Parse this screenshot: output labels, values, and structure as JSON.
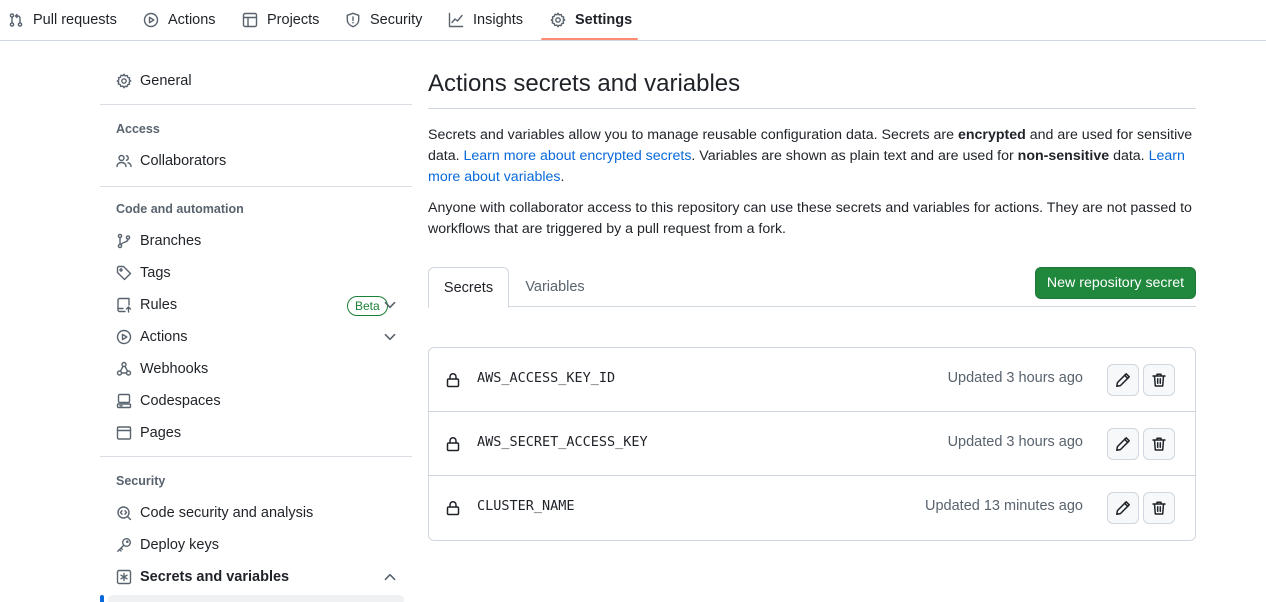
{
  "repo_nav": {
    "tabs": [
      {
        "label": "Pull requests",
        "icon": "git-pull-request-icon"
      },
      {
        "label": "Actions",
        "icon": "play-circle-icon"
      },
      {
        "label": "Projects",
        "icon": "table-icon"
      },
      {
        "label": "Security",
        "icon": "shield-icon"
      },
      {
        "label": "Insights",
        "icon": "graph-icon"
      },
      {
        "label": "Settings",
        "icon": "gear-icon",
        "selected": true
      }
    ]
  },
  "sidebar": {
    "general": "General",
    "access_heading": "Access",
    "collaborators": "Collaborators",
    "code_heading": "Code and automation",
    "branches": "Branches",
    "tags": "Tags",
    "rules": "Rules",
    "rules_badge": "Beta",
    "actions": "Actions",
    "webhooks": "Webhooks",
    "codespaces": "Codespaces",
    "pages": "Pages",
    "security_heading": "Security",
    "code_security": "Code security and analysis",
    "deploy_keys": "Deploy keys",
    "secrets_vars": "Secrets and variables"
  },
  "main": {
    "title": "Actions secrets and variables",
    "desc1_a": "Secrets and variables allow you to manage reusable configuration data. Secrets are ",
    "desc1_b": "encrypted",
    "desc1_c": " and are used for sensitive data. ",
    "desc1_link1": "Learn more about encrypted secrets",
    "desc1_d": ". Variables are shown as plain text and are used for ",
    "desc1_e": "non-sensitive",
    "desc1_f": " data. ",
    "desc1_link2": "Learn more about variables",
    "desc1_g": ".",
    "desc2": "Anyone with collaborator access to this repository can use these secrets and variables for actions. They are not passed to workflows that are triggered by a pull request from a fork.",
    "tab_secrets": "Secrets",
    "tab_variables": "Variables",
    "new_secret_button": "New repository secret",
    "secrets": [
      {
        "name": "AWS_ACCESS_KEY_ID",
        "updated": "Updated 3 hours ago"
      },
      {
        "name": "AWS_SECRET_ACCESS_KEY",
        "updated": "Updated 3 hours ago"
      },
      {
        "name": "CLUSTER_NAME",
        "updated": "Updated 13 minutes ago"
      }
    ]
  },
  "colors": {
    "accent_underline": "#fd8c73",
    "primary_button": "#1f883d",
    "link": "#0969da",
    "beta_badge": "#1a7f37"
  }
}
